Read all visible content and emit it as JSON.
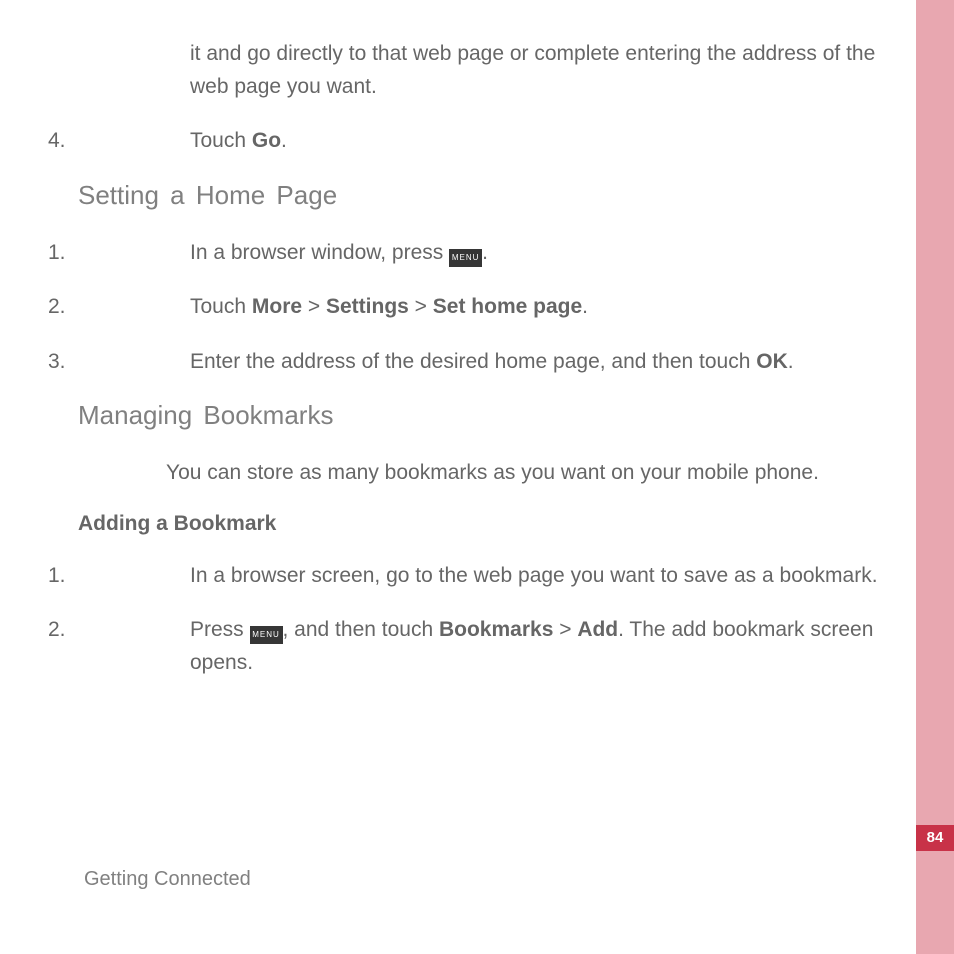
{
  "intro_fragment": "it and go directly to that web page or complete entering the address of the web page you want.",
  "step4_num": "4.",
  "step4_pre": "Touch ",
  "step4_bold": "Go",
  "step4_post": ".",
  "heading_home": "Setting a Home Page",
  "home_steps": {
    "s1_num": "1.",
    "s1_pre": "In a browser window, press ",
    "s1_post": ".",
    "s2_num": "2.",
    "s2_pre": "Touch ",
    "s2_b1": "More",
    "s2_sep1": " > ",
    "s2_b2": "Settings",
    "s2_sep2": " > ",
    "s2_b3": "Set home page",
    "s2_post": ".",
    "s3_num": "3.",
    "s3_pre": "Enter the address of the desired home page, and then touch ",
    "s3_bold": "OK",
    "s3_post": "."
  },
  "heading_bookmarks": "Managing Bookmarks",
  "bookmarks_intro": "You can store as many bookmarks as you want on your mobile phone.",
  "heading_add_bookmark": "Adding a Bookmark",
  "add_steps": {
    "s1_num": "1.",
    "s1_text": "In a browser screen, go to the web page you want to save as a bookmark.",
    "s2_num": "2.",
    "s2_pre": "Press ",
    "s2_mid": ", and then touch ",
    "s2_b1": "Bookmarks",
    "s2_sep": " > ",
    "s2_b2": "Add",
    "s2_post": ". The add bookmark screen opens."
  },
  "menu_icon_label": "MENU",
  "footer": "Getting Connected",
  "page_number": "84"
}
